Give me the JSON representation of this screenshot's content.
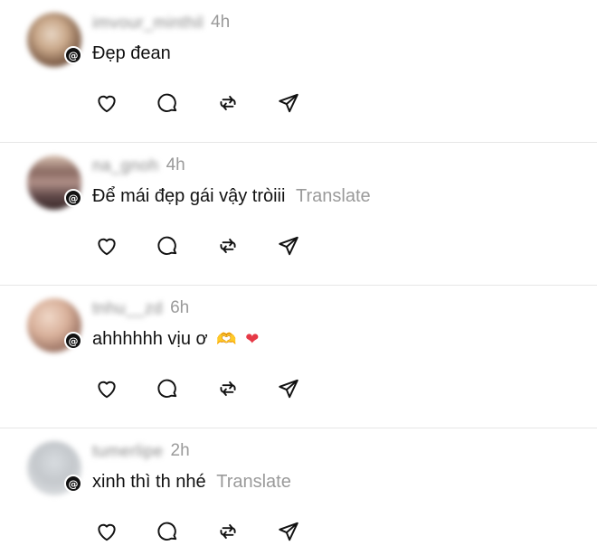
{
  "posts": [
    {
      "username": "imvour_minthil",
      "time": "4h",
      "text": "Đẹp đean",
      "translate": "",
      "emojis": []
    },
    {
      "username": "na_gnoh",
      "time": "4h",
      "text": "Để mái đẹp gái vậy tròiii",
      "translate": "Translate",
      "emojis": []
    },
    {
      "username": "tnhu__zd",
      "time": "6h",
      "text": "ahhhhhh vịu ơ",
      "translate": "",
      "emojis": [
        "🫶",
        "❤"
      ]
    },
    {
      "username": "tumerlipe",
      "time": "2h",
      "text": "xinh thì th nhé",
      "translate": "Translate",
      "emojis": []
    }
  ],
  "badge_icon": "threads-badge-icon",
  "action_icons": [
    "heart-icon",
    "comment-icon",
    "repost-icon",
    "share-icon"
  ],
  "colors": {
    "text": "#111111",
    "muted": "#9a9a9a",
    "divider": "#e6e6e6"
  }
}
